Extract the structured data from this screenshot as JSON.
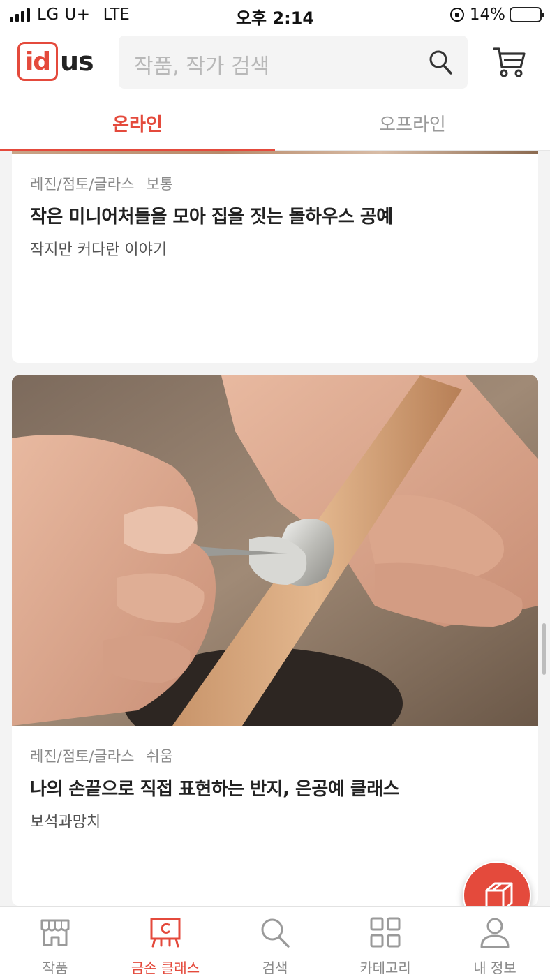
{
  "status_bar": {
    "carrier": "LG U+",
    "network": "LTE",
    "time": "오후 2:14",
    "battery_percent": "14%",
    "battery_level": 0.14
  },
  "header": {
    "logo_id": "id",
    "logo_us": "us",
    "search_placeholder": "작품, 작가 검색",
    "brand_color": "#e44a3c"
  },
  "tabs": [
    {
      "label": "온라인",
      "active": true
    },
    {
      "label": "오프라인",
      "active": false
    }
  ],
  "classes": [
    {
      "category": "레진/점토/글라스",
      "difficulty": "보통",
      "title": "작은 미니어처들을 모아 집을 짓는 돌하우스 공예",
      "artist": "작지만 커다란 이야기"
    },
    {
      "category": "레진/점토/글라스",
      "difficulty": "쉬움",
      "title": "나의 손끝으로 직접 표현하는 반지, 은공예 클래스",
      "artist": "보석과망치",
      "image": "hands-forming-silver-ring-on-wooden-mandrel"
    }
  ],
  "fab": {
    "icon": "package-box-icon"
  },
  "bottom_nav": [
    {
      "label": "작품",
      "icon": "store-icon",
      "active": false
    },
    {
      "label": "금손 클래스",
      "icon": "class-board-icon",
      "active": true
    },
    {
      "label": "검색",
      "icon": "search-icon",
      "active": false
    },
    {
      "label": "카테고리",
      "icon": "grid-icon",
      "active": false
    },
    {
      "label": "내 정보",
      "icon": "person-icon",
      "active": false
    }
  ]
}
